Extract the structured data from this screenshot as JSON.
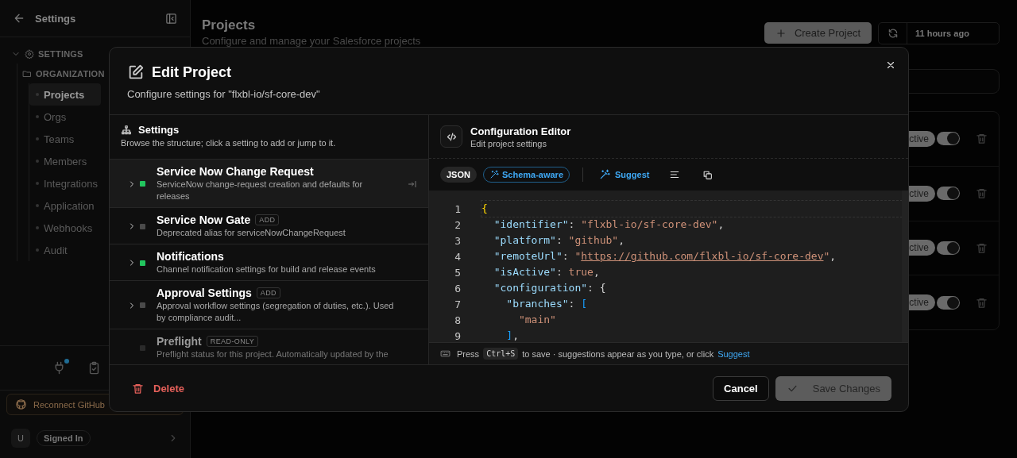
{
  "sidebar": {
    "title": "Settings",
    "tree": [
      {
        "label": "SETTINGS",
        "expanded": true,
        "children": [
          {
            "label": "ORGANIZATION",
            "expanded": true,
            "children": [
              {
                "label": "Projects",
                "selected": true
              },
              {
                "label": "Orgs",
                "selected": false
              },
              {
                "label": "Teams",
                "selected": false
              },
              {
                "label": "Members",
                "selected": false
              },
              {
                "label": "Integrations",
                "selected": false
              },
              {
                "label": "Application",
                "selected": false
              },
              {
                "label": "Webhooks",
                "selected": false
              },
              {
                "label": "Audit",
                "selected": false
              }
            ]
          }
        ]
      }
    ],
    "tools": [
      {
        "kind": "plug",
        "notified": true
      },
      {
        "kind": "clipboard",
        "notified": false
      }
    ],
    "github_button": "Reconnect GitHub",
    "user": {
      "initial": "U",
      "status": "Signed In"
    }
  },
  "page": {
    "title": "Projects",
    "subtitle": "Configure and manage your Salesforce projects",
    "create_button": "Create Project",
    "last_sync": "11 hours ago",
    "rows": [
      {
        "status": "ctive",
        "enabled": true
      },
      {
        "status": "ctive",
        "enabled": true
      },
      {
        "status": "ctive",
        "enabled": true
      },
      {
        "status": "ctive",
        "enabled": true
      }
    ]
  },
  "modal": {
    "title": "Edit Project",
    "subtitle": "Configure settings for \"flxbl-io/sf-core-dev\"",
    "settings": {
      "title": "Settings",
      "description": "Browse the structure; click a setting to add or jump to it.",
      "items": [
        {
          "title": "Service Now Change Request",
          "description": "ServiceNow change-request creation and defaults for releases",
          "color": "#22c55e",
          "selected": true,
          "disabled": false
        },
        {
          "title": "Service Now Gate",
          "badge": "ADD",
          "description": "Deprecated alias for serviceNowChangeRequest",
          "color": "#4a4a4a",
          "selected": false,
          "disabled": false
        },
        {
          "title": "Notifications",
          "description": "Channel notification settings for build and release events",
          "color": "#22c55e",
          "selected": false,
          "disabled": false
        },
        {
          "title": "Approval Settings",
          "badge": "ADD",
          "description": "Approval workflow settings (segregation of duties, etc.). Used by compliance audit...",
          "color": "#4a4a4a",
          "selected": false,
          "disabled": false
        },
        {
          "title": "Preflight",
          "badge": "READ-ONLY",
          "description": "Preflight status for this project. Automatically updated by the",
          "color": "#2a2a2a",
          "selected": false,
          "disabled": true
        }
      ]
    },
    "editor": {
      "title": "Configuration Editor",
      "description": "Edit project settings",
      "format": "JSON",
      "schema_chip": "Schema-aware",
      "suggest_button": "Suggest",
      "lines": [
        {
          "number": "1",
          "current": true,
          "tokens": [
            {
              "kind": "brace",
              "text": "{"
            }
          ]
        },
        {
          "number": "2",
          "current": false,
          "tokens": [
            {
              "kind": "key",
              "text": "  \"identifier\""
            },
            {
              "kind": "punct",
              "text": ": "
            },
            {
              "kind": "string",
              "text": "\"flxbl-io/sf-core-dev\""
            },
            {
              "kind": "punct",
              "text": ","
            }
          ]
        },
        {
          "number": "3",
          "current": false,
          "tokens": [
            {
              "kind": "key",
              "text": "  \"platform\""
            },
            {
              "kind": "punct",
              "text": ": "
            },
            {
              "kind": "string",
              "text": "\"github\""
            },
            {
              "kind": "punct",
              "text": ","
            }
          ]
        },
        {
          "number": "4",
          "current": false,
          "tokens": [
            {
              "kind": "key",
              "text": "  \"remoteUrl\""
            },
            {
              "kind": "punct",
              "text": ": "
            },
            {
              "kind": "string",
              "text": "\""
            },
            {
              "kind": "link",
              "text": "https://github.com/flxbl-io/sf-core-dev"
            },
            {
              "kind": "string",
              "text": "\""
            },
            {
              "kind": "punct",
              "text": ","
            }
          ]
        },
        {
          "number": "5",
          "current": false,
          "tokens": [
            {
              "kind": "key",
              "text": "  \"isActive\""
            },
            {
              "kind": "punct",
              "text": ": "
            },
            {
              "kind": "keyword",
              "text": "true"
            },
            {
              "kind": "punct",
              "text": ","
            }
          ]
        },
        {
          "number": "6",
          "current": false,
          "tokens": [
            {
              "kind": "key",
              "text": "  \"configuration\""
            },
            {
              "kind": "punct",
              "text": ": {"
            }
          ]
        },
        {
          "number": "7",
          "current": false,
          "tokens": [
            {
              "kind": "key",
              "text": "    \"branches\""
            },
            {
              "kind": "punct",
              "text": ": "
            },
            {
              "kind": "bracket",
              "text": "["
            }
          ]
        },
        {
          "number": "8",
          "current": false,
          "tokens": [
            {
              "kind": "string",
              "text": "      \"main\""
            }
          ]
        },
        {
          "number": "9",
          "current": false,
          "tokens": [
            {
              "kind": "bracket",
              "text": "    ]"
            },
            {
              "kind": "punct",
              "text": ","
            }
          ]
        }
      ],
      "hint": {
        "before": "Press",
        "key": "Ctrl+S",
        "after": "to save · suggestions appear as you type, or click",
        "link": "Suggest"
      }
    },
    "delete_button": "Delete",
    "cancel_button": "Cancel",
    "save_button": {
      "label": "Save Changes",
      "disabled": true
    }
  }
}
